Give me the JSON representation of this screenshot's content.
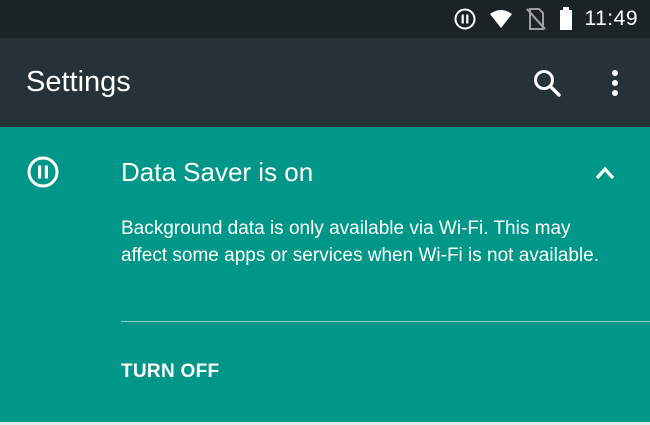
{
  "status_bar": {
    "time": "11:49",
    "icons": [
      "data-saver-icon",
      "wifi-icon",
      "no-sim-icon",
      "battery-icon"
    ]
  },
  "toolbar": {
    "title": "Settings",
    "search_icon": "search-icon",
    "overflow_icon": "more-vert-icon"
  },
  "data_saver_card": {
    "icon": "data-saver-icon",
    "title": "Data Saver is on",
    "description": "Background data is only available via Wi-Fi. This may affect some apps or services when Wi-Fi is not available.",
    "action_label": "TURN OFF",
    "collapse_icon": "chevron-up-icon"
  },
  "colors": {
    "status_bar_bg": "#1b2326",
    "toolbar_bg": "#263238",
    "accent_teal": "#009688",
    "text": "#ffffff"
  }
}
